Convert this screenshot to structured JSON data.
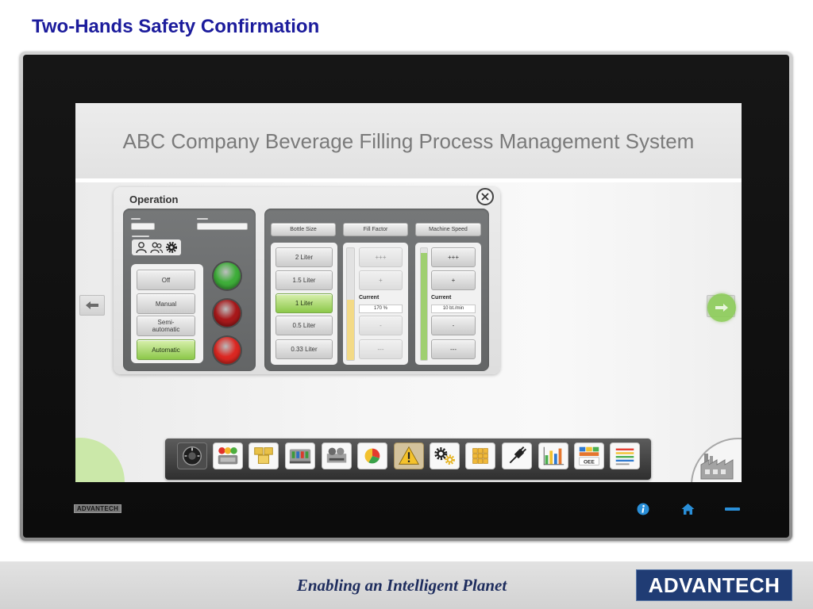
{
  "slide": {
    "title": "Two-Hands Safety Confirmation",
    "tagline": "Enabling an Intelligent Planet",
    "logo_text": "ADVANTECH"
  },
  "device": {
    "brand": "ADVANTECH",
    "icons": [
      "info-icon",
      "home-icon",
      "minus-icon"
    ]
  },
  "hmi": {
    "title": "ABC Company Beverage Filling Process Management System",
    "nav_icons": [
      "arrow-left-icon",
      "arrow-right-icon"
    ],
    "operation": {
      "title": "Operation",
      "user_icons": [
        "user-icon",
        "users-icon",
        "gear-icon"
      ],
      "modes": [
        "Off",
        "Manual",
        "Semi-automatic",
        "Automatic"
      ],
      "selected_mode": "Automatic",
      "status_lights": [
        {
          "color": "#3fae3a"
        },
        {
          "color": "#a8191b"
        },
        {
          "color": "#dc2822"
        }
      ],
      "bottle_size": {
        "label": "Bottle Size",
        "options": [
          "2 Liter",
          "1.5 Liter",
          "1 Liter",
          "0.5 Liter",
          "0.33 Liter"
        ],
        "selected": "1 Liter"
      },
      "fill_factor": {
        "label": "Fill Factor",
        "buttons": [
          "+++",
          "+",
          "-",
          "---"
        ],
        "current_label": "Current",
        "current_value": "170 %",
        "level": 0.54,
        "enabled": false
      },
      "machine_speed": {
        "label": "Machine Speed",
        "buttons": [
          "+++",
          "+",
          "-",
          "---"
        ],
        "current_label": "Current",
        "current_value": "10 bt./min",
        "level": 0.96,
        "enabled": true
      }
    },
    "toolbar": {
      "items": [
        {
          "icon": "dial-icon"
        },
        {
          "icon": "status-lights-icon"
        },
        {
          "icon": "boxes-icon"
        },
        {
          "icon": "filler-machine-icon"
        },
        {
          "icon": "capper-machine-icon"
        },
        {
          "icon": "pie-chart-icon"
        },
        {
          "icon": "warning-icon"
        },
        {
          "icon": "gears-icon"
        },
        {
          "icon": "pallet-icon"
        },
        {
          "icon": "plug-icon"
        },
        {
          "icon": "bar-chart-icon"
        },
        {
          "icon": "oee-icon",
          "text": "OEE"
        },
        {
          "icon": "report-list-icon"
        }
      ],
      "selected_index": 6
    },
    "corner_icon": "factory-icon"
  },
  "colors": {
    "slide_title": "#1c1c9c",
    "active_green": "#8cc84a",
    "fill_factor_bar": "#f3da86",
    "machine_speed_bar": "#9fcf70",
    "device_icon_blue": "#2a8fd8",
    "logo_navy": "#203c74"
  }
}
